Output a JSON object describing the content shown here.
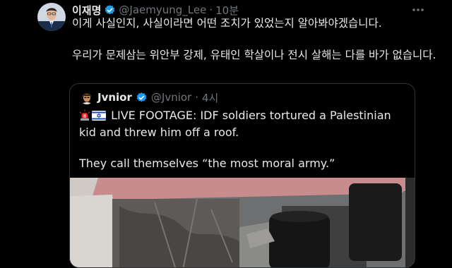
{
  "post": {
    "author_name": "이재명",
    "author_handle": "@Jaemyung_Lee",
    "separator": "·",
    "time": "10분",
    "text_line1": "이게 사실인지, 사실이라면 어떤 조치가 있었는지 알아봐야겠습니다.",
    "text_line2": "우리가 문제삼는 위안부 강제, 유태인 학살이나 전시 살해는 다를 바가 없습니다.",
    "more_icon": "more-horizontal-icon"
  },
  "quoted_post": {
    "author_name": "Jvnior",
    "author_handle": "@Jvnior",
    "separator": "·",
    "time": "4시",
    "text_line1": "LIVE FOOTAGE: IDF soldiers tortured a Palestinian kid and threw him off a roof.",
    "text_line2": "They call themselves “the most moral army.”"
  },
  "colors": {
    "background": "#000000",
    "text": "#e7e9ea",
    "muted": "#71767b",
    "verified": "#1d9bf0",
    "border": "#2f3336"
  }
}
